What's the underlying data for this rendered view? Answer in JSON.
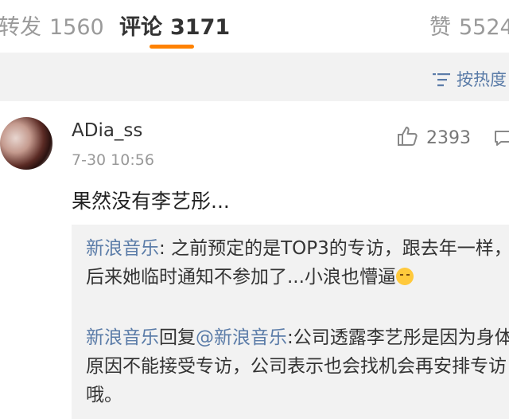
{
  "tabs": {
    "repost": {
      "label": "转发",
      "count": "1560"
    },
    "comment": {
      "label": "评论",
      "count": "3171"
    },
    "like": {
      "label": "赞",
      "count": "5524"
    }
  },
  "sort": {
    "label": "按热度"
  },
  "comment": {
    "username": "ADia_ss",
    "time": "7-30 10:56",
    "likes": "2393",
    "text": "果然没有李艺彤...",
    "replies": [
      {
        "author": "新浪音乐",
        "sep": ": ",
        "text": "之前预定的是TOP3的专访，跟去年一样，后来她临时通知不参加了...小浪也懵逼",
        "emoji": "sweat-emoji"
      },
      {
        "author": "新浪音乐",
        "action": "回复",
        "mention": "@新浪音乐",
        "sep": ":",
        "text": "公司透露李艺彤是因为身体原因不能接受专访，公司表示也会找机会再安排专访哦。"
      }
    ]
  },
  "colors": {
    "accent": "#ff8200",
    "link": "#5b7ca8",
    "muted": "#999999",
    "panel": "#f2f2f2"
  }
}
